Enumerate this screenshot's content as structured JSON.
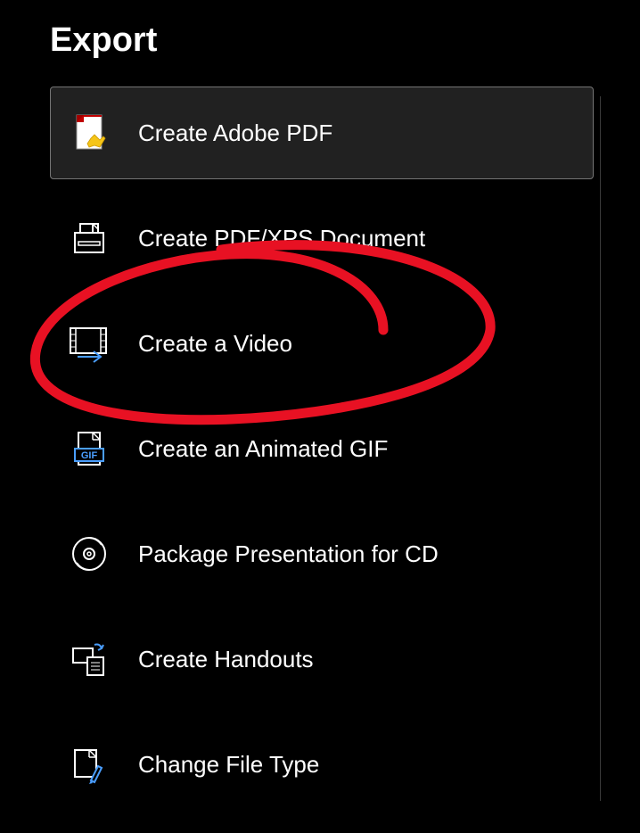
{
  "page": {
    "title": "Export"
  },
  "options": [
    {
      "id": "adobe-pdf",
      "label": "Create Adobe PDF",
      "selected": true
    },
    {
      "id": "pdf-xps",
      "label": "Create PDF/XPS Document",
      "selected": false
    },
    {
      "id": "video",
      "label": "Create a Video",
      "selected": false
    },
    {
      "id": "gif",
      "label": "Create an Animated GIF",
      "selected": false
    },
    {
      "id": "package-cd",
      "label": "Package Presentation for CD",
      "selected": false
    },
    {
      "id": "handouts",
      "label": "Create Handouts",
      "selected": false
    },
    {
      "id": "change-file-type",
      "label": "Change File Type",
      "selected": false
    }
  ],
  "annotation": {
    "type": "circle",
    "color": "#E81123",
    "target": "video"
  }
}
